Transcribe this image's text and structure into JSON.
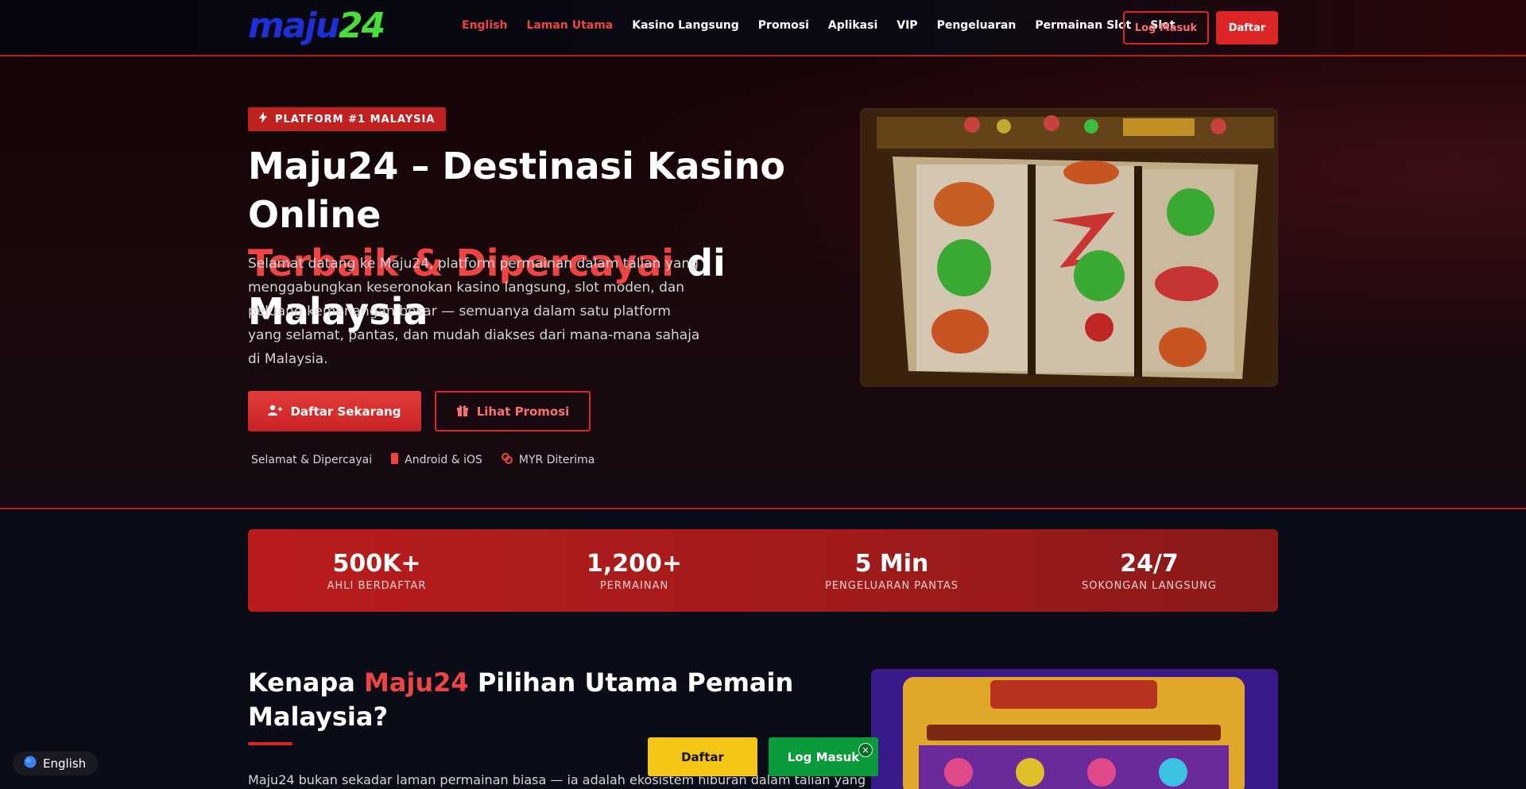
{
  "header": {
    "logo": {
      "part1": "maju",
      "part2": "24"
    },
    "nav": [
      {
        "label": "English",
        "active": true
      },
      {
        "label": "Laman Utama",
        "active": true
      },
      {
        "label": "Kasino Langsung",
        "active": false
      },
      {
        "label": "Promosi",
        "active": false
      },
      {
        "label": "Aplikasi",
        "active": false
      },
      {
        "label": "VIP",
        "active": false
      },
      {
        "label": "Pengeluaran",
        "active": false
      },
      {
        "label": "Permainan Slot",
        "active": false
      },
      {
        "label": "Slot",
        "active": false
      }
    ],
    "login_label": "Log Masuk",
    "register_label": "Daftar"
  },
  "hero": {
    "badge": "PLATFORM #1 MALAYSIA",
    "title_line1": "Maju24 – Destinasi Kasino Online",
    "title_red": "Terbaik & Dipercayai",
    "title_tail": " di Malaysia",
    "description": "Selamat datang ke Maju24, platform permainan dalam talian yang menggabungkan keseronokan kasino langsung, slot moden, dan peluang kemenangan besar — semuanya dalam satu platform yang selamat, pantas, dan mudah diakses dari mana-mana sahaja di Malaysia.",
    "cta_primary": "Daftar Sekarang",
    "cta_secondary": "Lihat Promosi",
    "features": [
      "Selamat & Dipercayai",
      "Android & iOS",
      "MYR Diterima"
    ]
  },
  "stats": [
    {
      "value": "500K+",
      "label": "AHLI BERDAFTAR"
    },
    {
      "value": "1,200+",
      "label": "PERMAINAN"
    },
    {
      "value": "5 Min",
      "label": "PENGELUARAN PANTAS"
    },
    {
      "value": "24/7",
      "label": "SOKONGAN LANGSUNG"
    }
  ],
  "section2": {
    "title_pre": "Kenapa ",
    "title_red": "Maju24",
    "title_post": " Pilihan Utama Pemain Malaysia?",
    "text": "Maju24 bukan sekadar laman permainan biasa — ia adalah ekosistem hiburan dalam talian yang"
  },
  "floating": {
    "language": "English",
    "register_label": "Daftar",
    "login_label": "Log Masuk",
    "close_symbol": "✕"
  }
}
